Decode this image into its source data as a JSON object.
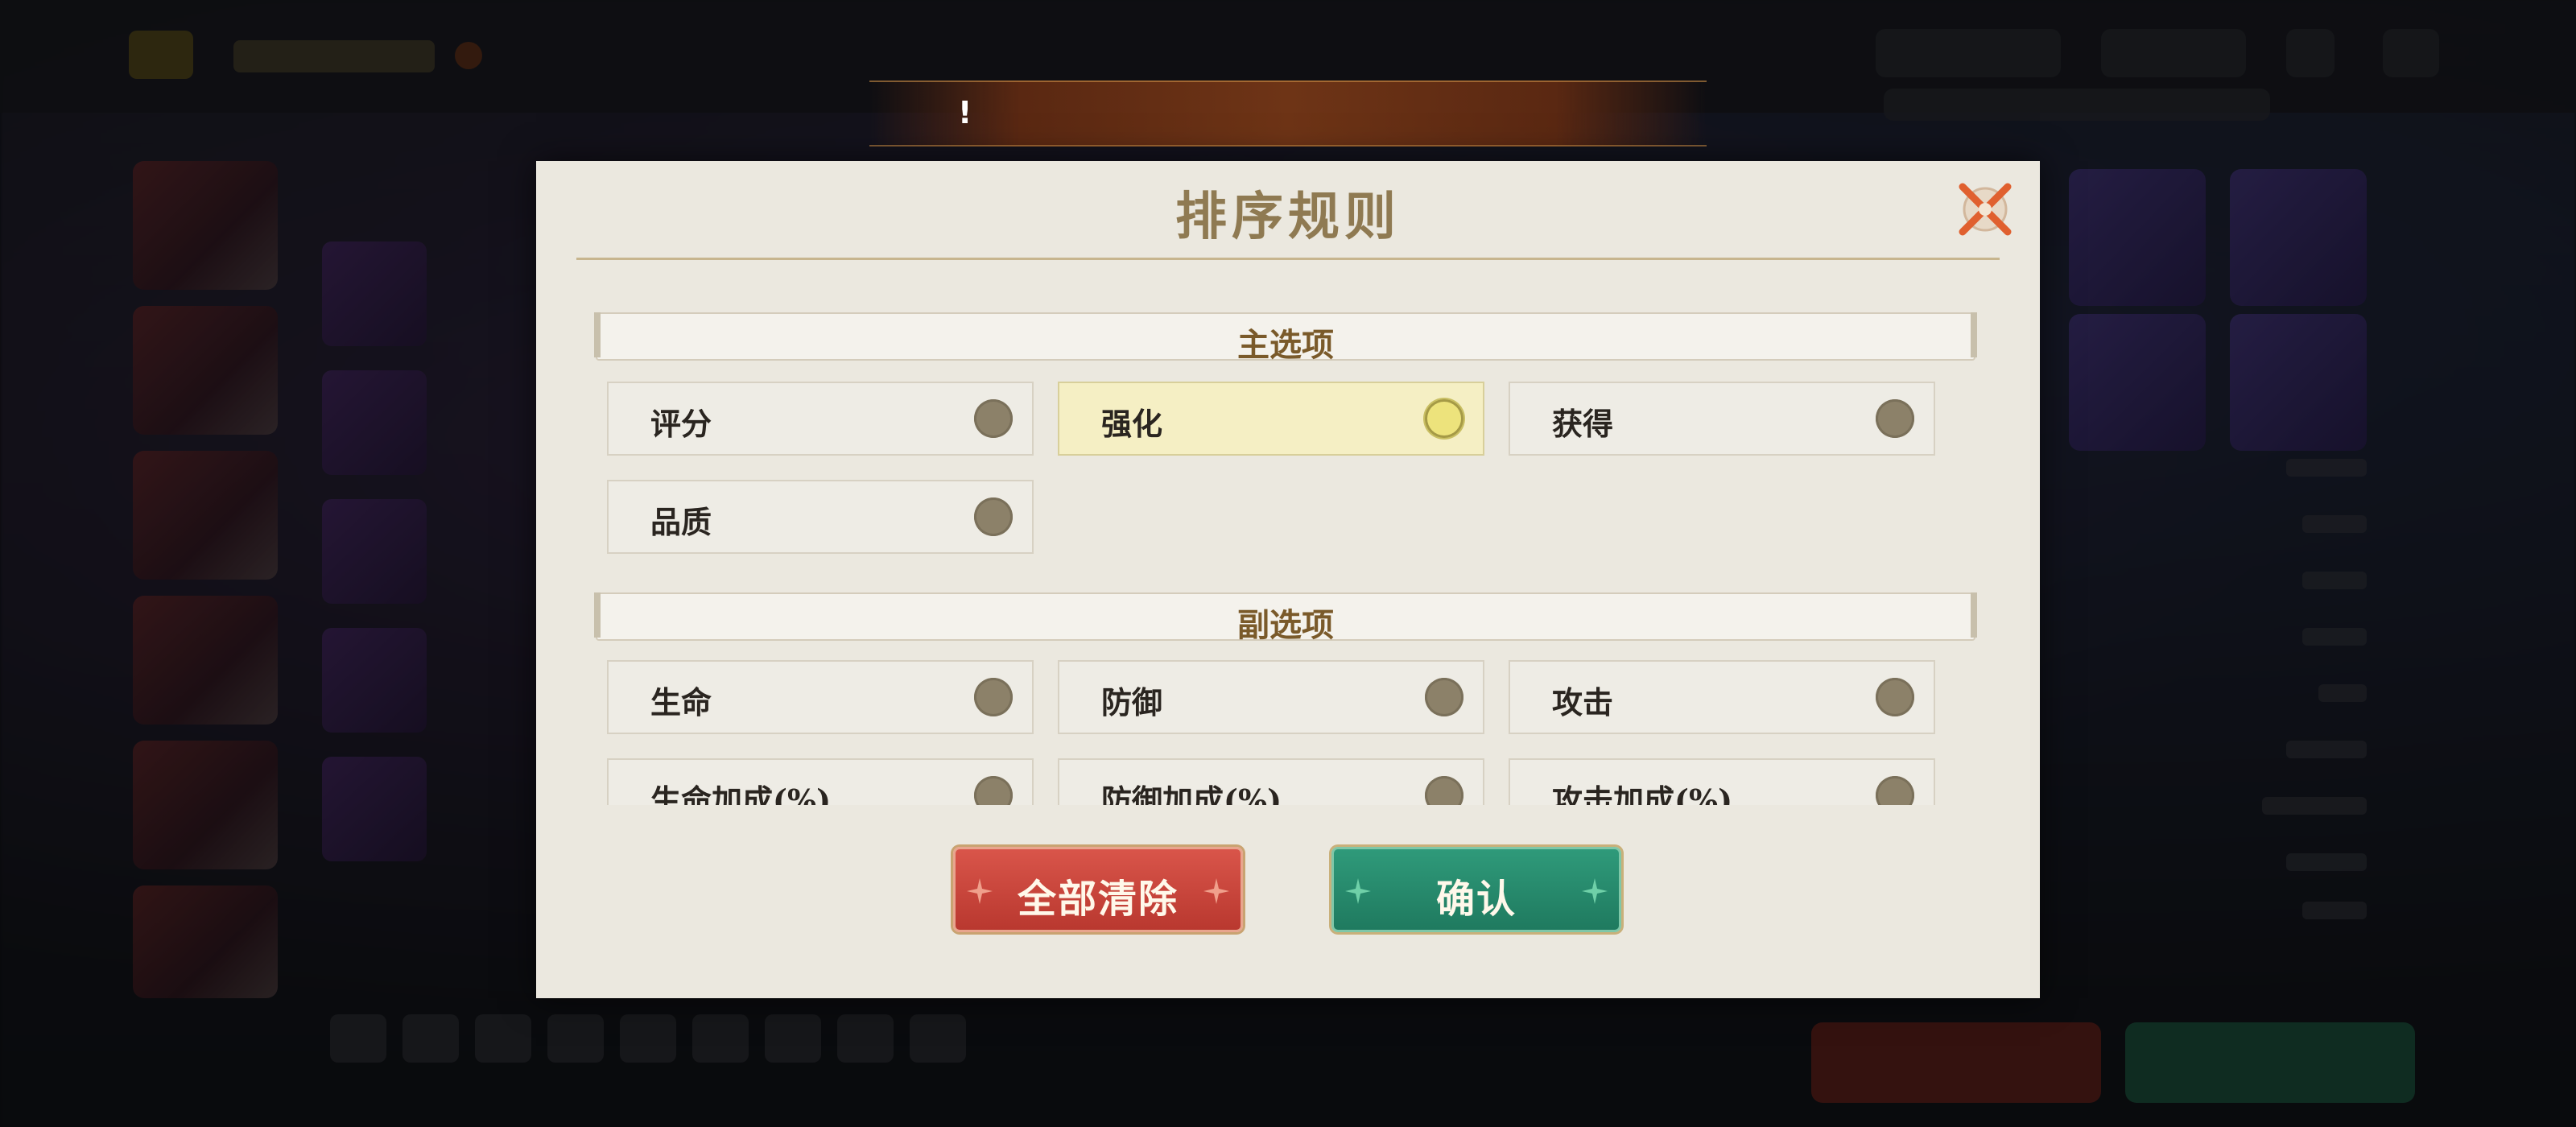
{
  "banner": {
    "icon": "!"
  },
  "dialog": {
    "title": "排序规则",
    "close_icon": "close-icon",
    "primary": {
      "label": "主选项",
      "options": [
        {
          "label": "评分",
          "selected": false
        },
        {
          "label": "强化",
          "selected": true
        },
        {
          "label": "获得",
          "selected": false
        },
        {
          "label": "品质",
          "selected": false
        }
      ]
    },
    "secondary": {
      "label": "副选项",
      "options": [
        {
          "label": "生命",
          "selected": false
        },
        {
          "label": "防御",
          "selected": false
        },
        {
          "label": "攻击",
          "selected": false
        },
        {
          "label": "生命加成(%)",
          "selected": false
        },
        {
          "label": "防御加成(%)",
          "selected": false
        },
        {
          "label": "攻击加成(%)",
          "selected": false
        }
      ]
    },
    "buttons": {
      "clear": "全部清除",
      "confirm": "确认"
    }
  },
  "colors": {
    "accent_red": "#c9463b",
    "accent_green": "#268a6b",
    "selected_bg": "#f5efc4",
    "title_gold": "#8f7a52"
  }
}
